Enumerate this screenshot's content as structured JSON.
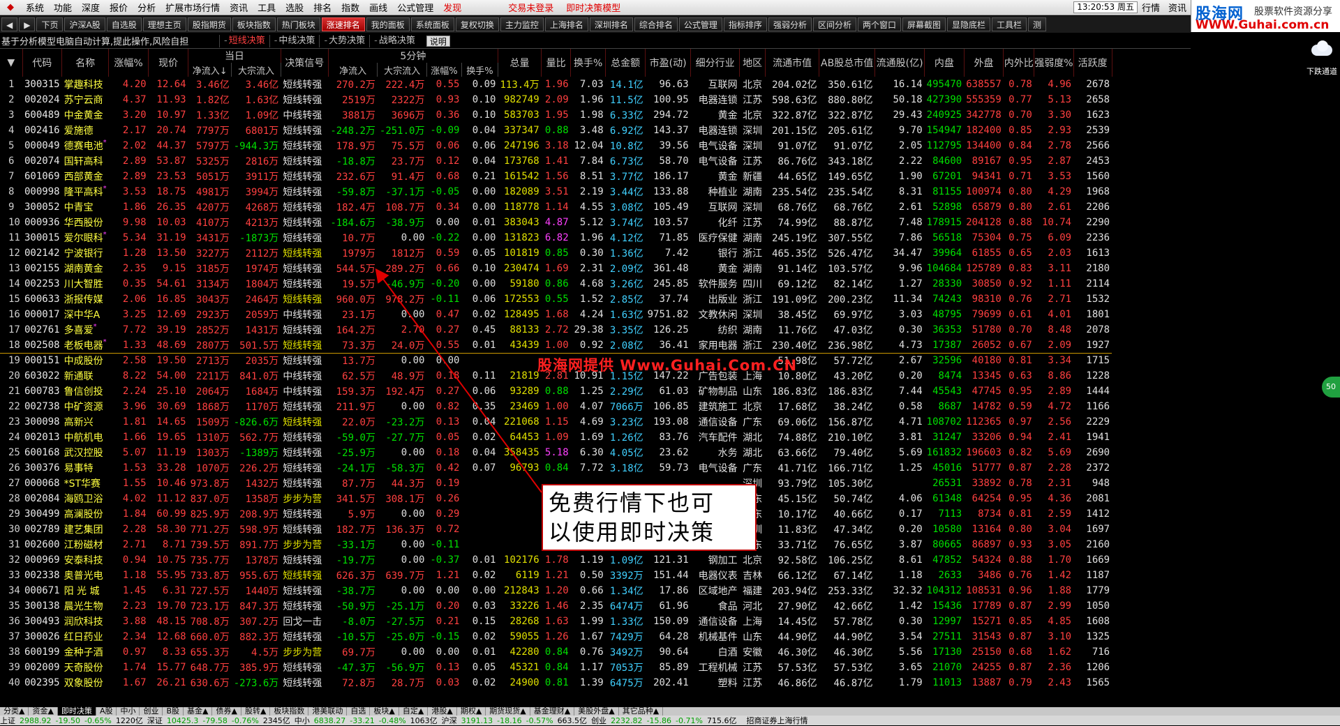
{
  "menu": {
    "items": [
      "系统",
      "功能",
      "深度",
      "报价",
      "分析",
      "扩展市场行情",
      "资讯",
      "工具",
      "选股",
      "排名",
      "指数",
      "画线",
      "公式管理"
    ],
    "red_item": "发现",
    "login": "交易未登录",
    "model": "即时决策模型",
    "clock": "13:20:53 周五",
    "right_items": [
      "行情",
      "资讯"
    ]
  },
  "brand": {
    "b1": "股海网",
    "b2": "股票软件资源分享",
    "b3": "WWW.Guhai.com.cn"
  },
  "toolbar": {
    "items": [
      "◀",
      "▶",
      "下页",
      "沪深A股",
      "自选股",
      "理想主页",
      "股指期货",
      "板块指数",
      "热门板块",
      "涨速排名",
      "我的面板",
      "系统面板",
      "复权切换",
      "主力监控",
      "上海排名",
      "深圳排名",
      "综合排名",
      "公式管理",
      "指标排序",
      "强弱分析",
      "区间分析",
      "两个窗口",
      "屏幕截图",
      "显隐底栏",
      "工具栏",
      "测"
    ],
    "active": "涨速排名"
  },
  "descbar": {
    "text": "基于分析模型电脑自动计算,提此操作,风险自担",
    "tabs": [
      "短线决策",
      "中线决策",
      "大势决策",
      "战略决策"
    ],
    "active": "短线决策",
    "help": "说明"
  },
  "weather": {
    "label": "下跌通道"
  },
  "columns": {
    "groups": {
      "today": "当日",
      "five": "5分钟"
    },
    "hdr": [
      "代码",
      "名称",
      "涨幅%",
      "现价",
      "决策信号",
      "总量",
      "量比",
      "换手%",
      "总金额",
      "市盈(动)",
      "细分行业",
      "地区",
      "流通市值",
      "AB股总市值",
      "流通股(亿)",
      "内盘",
      "外盘",
      "内外比",
      "强弱度%",
      "活跃度"
    ],
    "today_sub": [
      "净流入↓",
      "大宗流入"
    ],
    "five_sub": [
      "净流入",
      "大宗流入",
      "涨幅%",
      "换手%"
    ]
  },
  "rows": [
    [
      "1",
      "300315",
      "掌趣科技",
      "4.20",
      "12.64",
      "3.46亿",
      "3.46亿",
      "短线转强",
      "270.2万",
      "222.4万",
      "0.55",
      "0.09",
      "113.4万",
      "1.96",
      "7.03",
      "14.1亿",
      "96.63",
      "互联网",
      "北京",
      "204.02亿",
      "350.61亿",
      "16.14",
      "495470",
      "638557",
      "0.78",
      "4.96",
      "2678"
    ],
    [
      "2",
      "002024",
      "苏宁云商",
      "4.37",
      "11.93",
      "1.82亿",
      "1.63亿",
      "短线转强",
      "2519万",
      "2322万",
      "0.93",
      "0.10",
      "982749",
      "2.09",
      "1.96",
      "11.5亿",
      "100.95",
      "电器连锁",
      "江苏",
      "598.63亿",
      "880.80亿",
      "50.18",
      "427390",
      "555359",
      "0.77",
      "5.13",
      "2658"
    ],
    [
      "3",
      "600489",
      "中金黄金",
      "3.20",
      "10.97",
      "1.33亿",
      "1.09亿",
      "中线转强",
      "3881万",
      "3696万",
      "0.36",
      "0.10",
      "583703",
      "1.95",
      "1.98",
      "6.33亿",
      "294.72",
      "黄金",
      "北京",
      "322.87亿",
      "322.87亿",
      "29.43",
      "240925",
      "342778",
      "0.70",
      "3.30",
      "1623"
    ],
    [
      "4",
      "002416",
      "爱施德",
      "2.17",
      "20.74",
      "7797万",
      "6801万",
      "短线转强",
      "-248.2万",
      "-251.0万",
      "-0.09",
      "0.04",
      "337347",
      "0.88",
      "3.48",
      "6.92亿",
      "143.37",
      "电器连锁",
      "深圳",
      "201.15亿",
      "205.61亿",
      "9.70",
      "154947",
      "182400",
      "0.85",
      "2.93",
      "2539"
    ],
    [
      "5",
      "000049",
      "德赛电池",
      "2.02",
      "44.37",
      "5797万",
      "-944.3万",
      "短线转强",
      "178.9万",
      "75.5万",
      "0.06",
      "0.06",
      "247196",
      "3.18",
      "12.04",
      "10.8亿",
      "39.56",
      "电气设备",
      "深圳",
      "91.07亿",
      "91.07亿",
      "2.05",
      "112795",
      "134400",
      "0.84",
      "2.78",
      "2566"
    ],
    [
      "6",
      "002074",
      "国轩高科",
      "2.89",
      "53.87",
      "5325万",
      "2816万",
      "短线转强",
      "-18.8万",
      "23.7万",
      "0.12",
      "0.04",
      "173768",
      "1.41",
      "7.84",
      "6.73亿",
      "58.70",
      "电气设备",
      "江苏",
      "86.76亿",
      "343.18亿",
      "2.22",
      "84600",
      "89167",
      "0.95",
      "2.87",
      "2453"
    ],
    [
      "7",
      "601069",
      "西部黄金",
      "2.89",
      "23.53",
      "5051万",
      "3911万",
      "短线转强",
      "232.6万",
      "91.4万",
      "0.68",
      "0.21",
      "161542",
      "1.56",
      "8.51",
      "3.77亿",
      "186.17",
      "黄金",
      "新疆",
      "44.65亿",
      "149.65亿",
      "1.90",
      "67201",
      "94341",
      "0.71",
      "3.53",
      "1560"
    ],
    [
      "8",
      "000998",
      "隆平高科",
      "3.53",
      "18.75",
      "4981万",
      "3994万",
      "短线转强",
      "-59.8万",
      "-37.1万",
      "-0.05",
      "0.00",
      "182089",
      "3.51",
      "2.19",
      "3.44亿",
      "133.88",
      "种植业",
      "湖南",
      "235.54亿",
      "235.54亿",
      "8.31",
      "81155",
      "100974",
      "0.80",
      "4.29",
      "1968"
    ],
    [
      "9",
      "300052",
      "中青宝",
      "1.86",
      "26.35",
      "4207万",
      "4268万",
      "短线转强",
      "182.4万",
      "108.7万",
      "0.34",
      "0.00",
      "118778",
      "1.14",
      "4.55",
      "3.08亿",
      "105.49",
      "互联网",
      "深圳",
      "68.76亿",
      "68.76亿",
      "2.61",
      "52898",
      "65879",
      "0.80",
      "2.61",
      "2206"
    ],
    [
      "10",
      "000936",
      "华西股份",
      "9.98",
      "10.03",
      "4107万",
      "4213万",
      "短线转强",
      "-184.6万",
      "-38.9万",
      "0.00",
      "0.01",
      "383043",
      "4.87",
      "5.12",
      "3.74亿",
      "103.57",
      "化纤",
      "江苏",
      "74.99亿",
      "88.87亿",
      "7.48",
      "178915",
      "204128",
      "0.88",
      "10.74",
      "2290"
    ],
    [
      "11",
      "300015",
      "爱尔眼科",
      "5.34",
      "31.19",
      "3431万",
      "-1873万",
      "短线转强",
      "10.7万",
      "0.00",
      "-0.22",
      "0.00",
      "131823",
      "6.82",
      "1.96",
      "4.12亿",
      "71.85",
      "医疗保健",
      "湖南",
      "245.19亿",
      "307.55亿",
      "7.86",
      "56518",
      "75304",
      "0.75",
      "6.09",
      "2236"
    ],
    [
      "12",
      "002142",
      "宁波银行",
      "1.28",
      "13.50",
      "3227万",
      "2112万",
      "短线转强",
      "1979万",
      "1812万",
      "0.59",
      "0.05",
      "101819",
      "0.85",
      "0.30",
      "1.36亿",
      "7.42",
      "银行",
      "浙江",
      "465.35亿",
      "526.47亿",
      "34.47",
      "39964",
      "61855",
      "0.65",
      "2.03",
      "1613"
    ],
    [
      "13",
      "002155",
      "湖南黄金",
      "2.35",
      "9.15",
      "3185万",
      "1974万",
      "短线转强",
      "544.5万",
      "289.2万",
      "0.66",
      "0.10",
      "230474",
      "1.69",
      "2.31",
      "2.09亿",
      "361.48",
      "黄金",
      "湖南",
      "91.14亿",
      "103.57亿",
      "9.96",
      "104684",
      "125789",
      "0.83",
      "3.11",
      "2180"
    ],
    [
      "14",
      "002253",
      "川大智胜",
      "0.35",
      "54.61",
      "3134万",
      "1804万",
      "短线转强",
      "19.5万",
      "-46.9万",
      "-0.20",
      "0.00",
      "59180",
      "0.86",
      "4.68",
      "3.26亿",
      "245.85",
      "软件服务",
      "四川",
      "69.12亿",
      "82.14亿",
      "1.27",
      "28330",
      "30850",
      "0.92",
      "1.11",
      "2114"
    ],
    [
      "15",
      "600633",
      "浙报传媒",
      "2.06",
      "16.85",
      "3043万",
      "2464万",
      "短线转强",
      "960.0万",
      "978.2万",
      "-0.11",
      "0.06",
      "172553",
      "0.55",
      "1.52",
      "2.85亿",
      "37.74",
      "出版业",
      "浙江",
      "191.09亿",
      "200.23亿",
      "11.34",
      "74243",
      "98310",
      "0.76",
      "2.71",
      "1532"
    ],
    [
      "16",
      "000017",
      "深中华A",
      "3.25",
      "12.69",
      "2923万",
      "2059万",
      "中线转强",
      "23.1万",
      "0.00",
      "0.47",
      "0.02",
      "128495",
      "1.68",
      "4.24",
      "1.63亿",
      "9751.82",
      "文教休闲",
      "深圳",
      "38.45亿",
      "69.97亿",
      "3.03",
      "48795",
      "79699",
      "0.61",
      "4.01",
      "1801"
    ],
    [
      "17",
      "002761",
      "多喜爱",
      "7.72",
      "39.19",
      "2852万",
      "1431万",
      "短线转强",
      "164.2万",
      "2.70",
      "0.27",
      "0.45",
      "88133",
      "2.72",
      "29.38",
      "3.35亿",
      "126.25",
      "纺织",
      "湖南",
      "11.76亿",
      "47.03亿",
      "0.30",
      "36353",
      "51780",
      "0.70",
      "8.48",
      "2078"
    ],
    [
      "18",
      "002508",
      "老板电器",
      "1.33",
      "48.69",
      "2807万",
      "501.5万",
      "短线转强",
      "73.3万",
      "24.0万",
      "0.55",
      "0.01",
      "43439",
      "1.00",
      "0.92",
      "2.08亿",
      "36.41",
      "家用电器",
      "浙江",
      "230.40亿",
      "236.98亿",
      "4.73",
      "17387",
      "26052",
      "0.67",
      "2.09",
      "1927"
    ],
    [
      "19",
      "000151",
      "中成股份",
      "2.58",
      "19.50",
      "2713万",
      "2035万",
      "短线转强",
      "13.7万",
      "0.00",
      "0.00",
      "",
      "",
      "",
      "",
      "",
      "",
      "",
      "",
      "51.98亿",
      "57.72亿",
      "2.67",
      "32596",
      "40180",
      "0.81",
      "3.34",
      "1715"
    ],
    [
      "20",
      "603022",
      "新通联",
      "8.22",
      "54.00",
      "2211万",
      "841.0万",
      "中线转强",
      "62.5万",
      "48.9万",
      "0.18",
      "0.11",
      "21819",
      "2.81",
      "10.91",
      "1.15亿",
      "147.22",
      "广告包装",
      "上海",
      "10.80亿",
      "43.20亿",
      "0.20",
      "8474",
      "13345",
      "0.63",
      "8.86",
      "1228"
    ],
    [
      "21",
      "600783",
      "鲁信创投",
      "2.24",
      "25.10",
      "2064万",
      "1684万",
      "中线转强",
      "159.3万",
      "192.4万",
      "0.27",
      "0.06",
      "93289",
      "0.88",
      "1.25",
      "2.29亿",
      "61.03",
      "矿物制品",
      "山东",
      "186.83亿",
      "186.83亿",
      "7.44",
      "45543",
      "47745",
      "0.95",
      "2.89",
      "1444"
    ],
    [
      "22",
      "002738",
      "中矿资源",
      "3.96",
      "30.69",
      "1868万",
      "1170万",
      "短线转强",
      "211.9万",
      "0.00",
      "0.82",
      "0.35",
      "23469",
      "1.00",
      "4.07",
      "7066万",
      "106.85",
      "建筑施工",
      "北京",
      "17.68亿",
      "38.24亿",
      "0.58",
      "8687",
      "14782",
      "0.59",
      "4.72",
      "1166"
    ],
    [
      "23",
      "300098",
      "高新兴",
      "1.81",
      "14.65",
      "1509万",
      "-826.6万",
      "短线转强",
      "22.0万",
      "-23.2万",
      "0.13",
      "0.04",
      "221068",
      "1.15",
      "4.69",
      "3.23亿",
      "193.08",
      "通信设备",
      "广东",
      "69.06亿",
      "156.87亿",
      "4.71",
      "108702",
      "112365",
      "0.97",
      "2.56",
      "2229"
    ],
    [
      "24",
      "002013",
      "中航机电",
      "1.66",
      "19.65",
      "1310万",
      "562.7万",
      "短线转强",
      "-59.0万",
      "-27.7万",
      "0.05",
      "0.02",
      "64453",
      "1.09",
      "1.69",
      "1.26亿",
      "83.76",
      "汽车配件",
      "湖北",
      "74.88亿",
      "210.10亿",
      "3.81",
      "31247",
      "33206",
      "0.94",
      "2.41",
      "1941"
    ],
    [
      "25",
      "600168",
      "武汉控股",
      "5.07",
      "11.19",
      "1303万",
      "-1389万",
      "短线转强",
      "-25.9万",
      "0.00",
      "0.18",
      "0.04",
      "358435",
      "5.18",
      "6.30",
      "4.05亿",
      "23.62",
      "水务",
      "湖北",
      "63.66亿",
      "79.40亿",
      "5.69",
      "161832",
      "196603",
      "0.82",
      "5.69",
      "2690"
    ],
    [
      "26",
      "300376",
      "易事特",
      "1.53",
      "33.28",
      "1070万",
      "226.2万",
      "短线转强",
      "-24.1万",
      "-58.3万",
      "0.42",
      "0.07",
      "96793",
      "0.84",
      "7.72",
      "3.18亿",
      "59.73",
      "电气设备",
      "广东",
      "41.71亿",
      "166.71亿",
      "1.25",
      "45016",
      "51777",
      "0.87",
      "2.28",
      "2372"
    ],
    [
      "27",
      "000068",
      "*ST华赛",
      "1.55",
      "10.46",
      "973.8万",
      "1432万",
      "短线转强",
      "87.7万",
      "44.3万",
      "0.19",
      "",
      "",
      "",
      "",
      "",
      "",
      "",
      "深圳",
      "93.79亿",
      "105.30亿",
      "",
      "26531",
      "33892",
      "0.78",
      "2.31",
      "948"
    ],
    [
      "28",
      "002084",
      "海鸥卫浴",
      "4.02",
      "11.12",
      "837.0万",
      "1358万",
      "步步为营",
      "341.5万",
      "308.1万",
      "0.26",
      "",
      "",
      "",
      "",
      "",
      "",
      "家居用品",
      "广东",
      "45.15亿",
      "50.74亿",
      "4.06",
      "61348",
      "64254",
      "0.95",
      "4.36",
      "2081"
    ],
    [
      "29",
      "300499",
      "高澜股份",
      "1.84",
      "60.99",
      "825.9万",
      "208.9万",
      "短线转强",
      "5.9万",
      "0.00",
      "0.29",
      "",
      "",
      "",
      "",
      "",
      "",
      "专用机械",
      "广东",
      "10.17亿",
      "40.66亿",
      "0.17",
      "7113",
      "8734",
      "0.81",
      "2.59",
      "1412"
    ],
    [
      "30",
      "002789",
      "建艺集团",
      "2.28",
      "58.30",
      "771.2万",
      "598.9万",
      "短线转强",
      "182.7万",
      "136.3万",
      "0.72",
      "",
      "",
      "",
      "",
      "",
      "",
      "装修装饰",
      "深圳",
      "11.83亿",
      "47.34亿",
      "0.20",
      "10580",
      "13164",
      "0.80",
      "3.04",
      "1697"
    ],
    [
      "31",
      "002600",
      "江粉磁材",
      "2.71",
      "8.71",
      "739.5万",
      "891.7万",
      "步步为营",
      "-33.1万",
      "0.00",
      "-0.11",
      "",
      "",
      "",
      "",
      "",
      "",
      "元器件",
      "广东",
      "33.71亿",
      "76.65亿",
      "3.87",
      "80665",
      "86897",
      "0.93",
      "3.05",
      "2160"
    ],
    [
      "32",
      "000969",
      "安泰科技",
      "0.94",
      "10.75",
      "735.7万",
      "1378万",
      "短线转强",
      "-19.7万",
      "0.00",
      "-0.37",
      "0.01",
      "102176",
      "1.78",
      "1.19",
      "1.09亿",
      "121.31",
      "钢加工",
      "北京",
      "92.58亿",
      "106.25亿",
      "8.61",
      "47852",
      "54324",
      "0.88",
      "1.70",
      "1669"
    ],
    [
      "33",
      "002338",
      "奥普光电",
      "1.18",
      "55.95",
      "733.8万",
      "955.6万",
      "短线转强",
      "626.3万",
      "639.7万",
      "1.21",
      "0.02",
      "6119",
      "1.21",
      "0.50",
      "3392万",
      "151.44",
      "电器仪表",
      "吉林",
      "66.12亿",
      "67.14亿",
      "1.18",
      "2633",
      "3486",
      "0.76",
      "1.42",
      "1187"
    ],
    [
      "34",
      "000671",
      "阳 光 城",
      "1.45",
      "6.31",
      "727.5万",
      "1440万",
      "短线转强",
      "-38.7万",
      "0.00",
      "0.00",
      "0.00",
      "212843",
      "1.20",
      "0.66",
      "1.34亿",
      "17.86",
      "区域地产",
      "福建",
      "203.94亿",
      "253.33亿",
      "32.32",
      "104312",
      "108531",
      "0.96",
      "1.88",
      "1779"
    ],
    [
      "35",
      "300138",
      "晨光生物",
      "2.23",
      "19.70",
      "723.1万",
      "847.3万",
      "短线转强",
      "-50.9万",
      "-25.1万",
      "0.20",
      "0.03",
      "33226",
      "1.46",
      "2.35",
      "6474万",
      "61.96",
      "食品",
      "河北",
      "27.90亿",
      "42.66亿",
      "1.42",
      "15436",
      "17789",
      "0.87",
      "2.99",
      "1050"
    ],
    [
      "36",
      "300493",
      "润欣科技",
      "3.88",
      "48.15",
      "708.8万",
      "307.2万",
      "回戈一击",
      "-8.0万",
      "-27.5万",
      "0.21",
      "0.15",
      "28268",
      "1.63",
      "1.99",
      "1.33亿",
      "150.09",
      "通信设备",
      "上海",
      "14.45亿",
      "57.78亿",
      "0.30",
      "12997",
      "15271",
      "0.85",
      "4.85",
      "1608"
    ],
    [
      "37",
      "300026",
      "红日药业",
      "2.34",
      "12.68",
      "660.0万",
      "882.3万",
      "短线转强",
      "-10.5万",
      "-25.0万",
      "-0.15",
      "0.02",
      "59055",
      "1.26",
      "1.67",
      "7429万",
      "64.28",
      "机械基件",
      "山东",
      "44.90亿",
      "44.90亿",
      "3.54",
      "27511",
      "31543",
      "0.87",
      "3.10",
      "1325"
    ],
    [
      "38",
      "600199",
      "金种子酒",
      "0.97",
      "8.33",
      "655.3万",
      "4.5万",
      "步步为营",
      "69.7万",
      "0.00",
      "0.00",
      "0.01",
      "42280",
      "0.84",
      "0.76",
      "3492万",
      "90.64",
      "白酒",
      "安徽",
      "46.30亿",
      "46.30亿",
      "5.56",
      "17130",
      "25150",
      "0.68",
      "1.62",
      "716"
    ],
    [
      "39",
      "002009",
      "天奇股份",
      "1.74",
      "15.77",
      "648.7万",
      "385.9万",
      "短线转强",
      "-47.3万",
      "-56.9万",
      "0.13",
      "0.05",
      "45321",
      "0.84",
      "1.17",
      "7053万",
      "85.89",
      "工程机械",
      "江苏",
      "57.53亿",
      "57.53亿",
      "3.65",
      "21070",
      "24255",
      "0.87",
      "2.36",
      "1206"
    ],
    [
      "40",
      "002395",
      "双象股份",
      "1.67",
      "26.21",
      "630.6万",
      "-273.6万",
      "短线转强",
      "72.8万",
      "28.7万",
      "0.03",
      "0.02",
      "24900",
      "0.81",
      "1.39",
      "6475万",
      "202.41",
      "塑料",
      "江苏",
      "46.86亿",
      "46.87亿",
      "1.79",
      "11013",
      "13887",
      "0.79",
      "2.43",
      "1565"
    ]
  ],
  "row_markers": {
    "5": "*",
    "8": "*",
    "11": "*",
    "17": "*",
    "18": "*"
  },
  "yellow_signals": [
    "12",
    "15",
    "18",
    "23",
    "28",
    "31",
    "33",
    "38"
  ],
  "tabs": {
    "items": [
      "分类▲",
      "资金▲",
      "即时决策",
      "A股",
      "中小",
      "创业",
      "B股",
      "基金▲",
      "债券▲",
      "股转▲",
      "板块指数",
      "港美联动",
      "自选",
      "板块▲",
      "自定▲",
      "港股▲",
      "期权▲",
      "期货现货▲",
      "基金理财▲",
      "美股外盘▲",
      "其它品种▲"
    ],
    "active": "即时决策"
  },
  "status": [
    {
      "label": "上证",
      "val": "2988.92",
      "chg": "-19.50",
      "pct": "-0.65%",
      "amt": "1220亿"
    },
    {
      "label": "深证",
      "val": "10425.3",
      "chg": "-79.58",
      "pct": "-0.76%",
      "amt": "2345亿"
    },
    {
      "label": "中小",
      "val": "6838.27",
      "chg": "-33.21",
      "pct": "-0.48%",
      "amt": "1063亿"
    },
    {
      "label": "沪深",
      "val": "3191.13",
      "chg": "-18.16",
      "pct": "-0.57%",
      "amt": "663.5亿"
    },
    {
      "label": "创业",
      "val": "2232.82",
      "chg": "-15.86",
      "pct": "-0.71%",
      "amt": "715.6亿"
    }
  ],
  "status_broker": "招商证券上海行情",
  "side_widget": "50",
  "watermark": "股海网提供 Www.Guhai.Com.CN",
  "callout": {
    "line1": "免费行情下也可",
    "line2": "以使用即时决策"
  },
  "colors": {
    "up": "#ff4040",
    "down": "#00e000",
    "accent": "#e00000",
    "callout_border": "#c00000"
  }
}
